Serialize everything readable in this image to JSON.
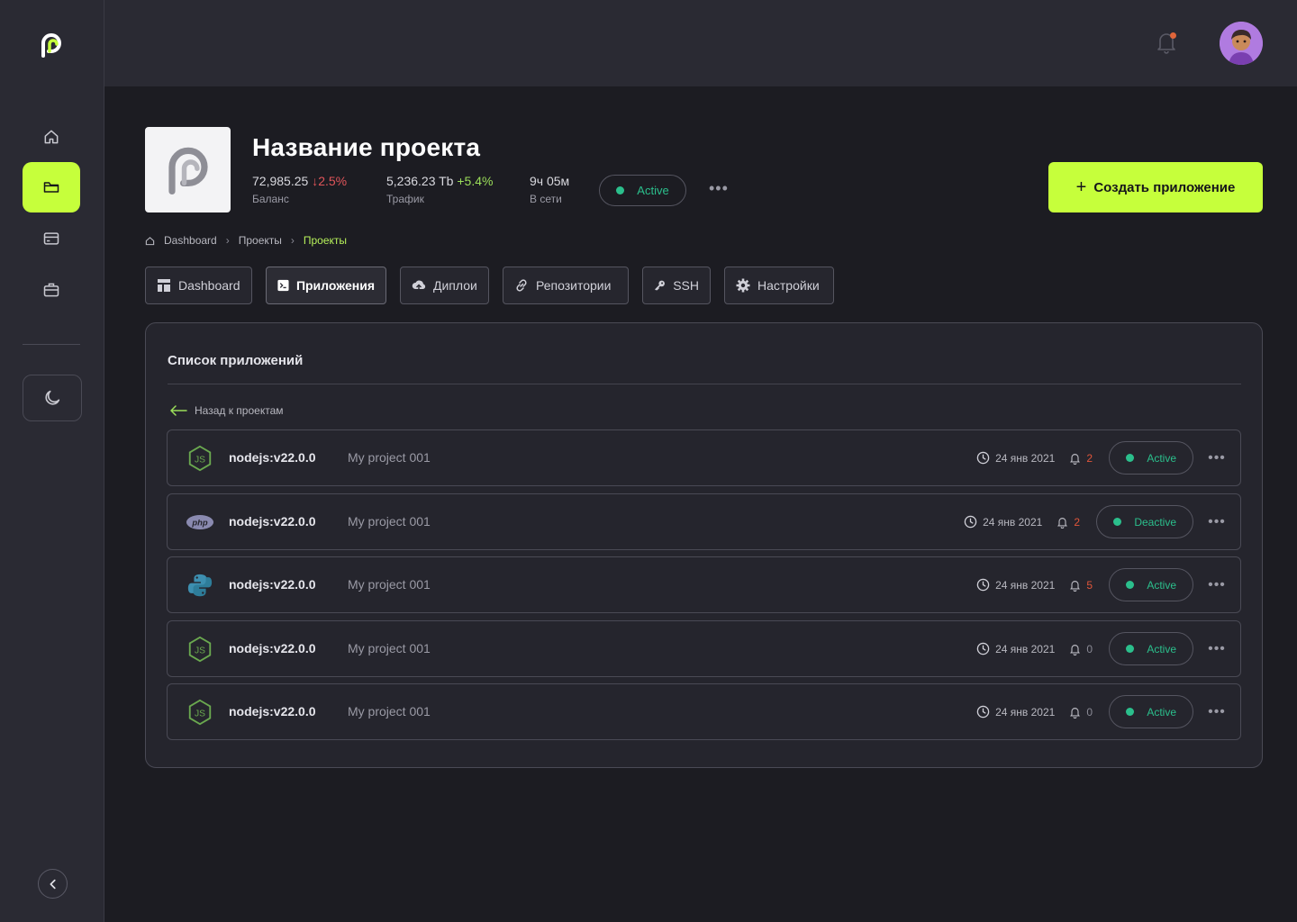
{
  "project": {
    "title": "Название проекта",
    "stats": [
      {
        "value": "72,985.25",
        "delta": "2.5%",
        "delta_dir": "down",
        "label": "Баланс"
      },
      {
        "value": "5,236.23 Tb",
        "delta": "+5.4%",
        "delta_dir": "up",
        "label": "Трафик"
      },
      {
        "value": "9ч 05м",
        "delta": "",
        "delta_dir": "",
        "label": "В сети"
      }
    ],
    "status": "Active",
    "create_button": "Создать приложение"
  },
  "breadcrumb": [
    "Dashboard",
    "Проекты",
    "Проекты"
  ],
  "tabs": [
    {
      "label": "Dashboard",
      "icon": "layout-icon"
    },
    {
      "label": "Приложения",
      "icon": "terminal-icon"
    },
    {
      "label": "Диплои",
      "icon": "cloud-upload-icon"
    },
    {
      "label": "Репозитории",
      "icon": "link-icon"
    },
    {
      "label": "SSH",
      "icon": "key-icon"
    },
    {
      "label": "Настройки",
      "icon": "gear-icon"
    }
  ],
  "apps_card": {
    "title": "Список приложений",
    "back_label": "Назад к проектам",
    "rows": [
      {
        "icon": "nodejs-icon",
        "name": "nodejs:v22.0.0",
        "project": "My project 001",
        "date": "24 янв 2021",
        "notifications": "2",
        "status": "Active"
      },
      {
        "icon": "php-icon",
        "name": "nodejs:v22.0.0",
        "project": "My project 001",
        "date": "24 янв 2021",
        "notifications": "2",
        "status": "Deactive"
      },
      {
        "icon": "python-icon",
        "name": "nodejs:v22.0.0",
        "project": "My project 001",
        "date": "24 янв 2021",
        "notifications": "5",
        "status": "Active"
      },
      {
        "icon": "nodejs-icon",
        "name": "nodejs:v22.0.0",
        "project": "My project 001",
        "date": "24 янв 2021",
        "notifications": "0",
        "status": "Active"
      },
      {
        "icon": "nodejs-icon",
        "name": "nodejs:v22.0.0",
        "project": "My project 001",
        "date": "24 янв 2021",
        "notifications": "0",
        "status": "Active"
      }
    ]
  },
  "colors": {
    "accent": "#c6ff3b",
    "status_green": "#2bbf8c",
    "alert_red": "#e0553a"
  }
}
